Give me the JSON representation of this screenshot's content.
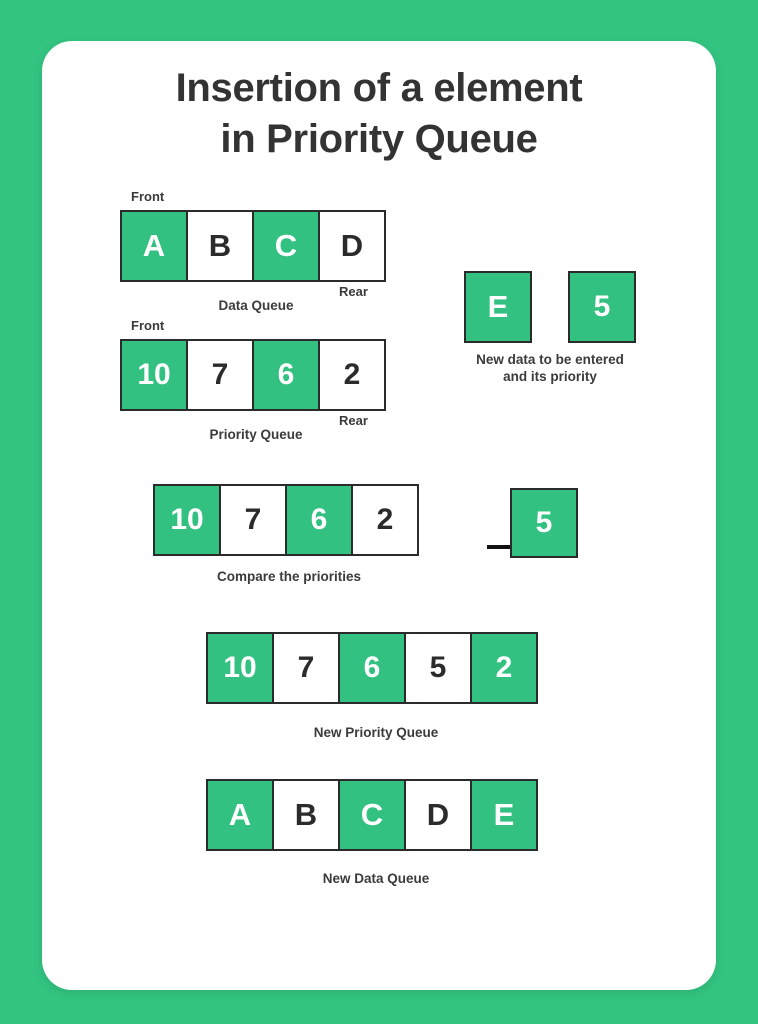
{
  "title": {
    "line1": "Insertion of a element",
    "line2": "in Priority Queue"
  },
  "colors": {
    "background_green": "#33c481",
    "cell_green": "#33c182",
    "border_dark": "#2b2b2b",
    "text_dark": "#333333",
    "card_white": "#ffffff"
  },
  "data_queue": {
    "front_label": "Front",
    "rear_label": "Rear",
    "caption": "Data Queue",
    "cells": [
      {
        "value": "A",
        "filled": true
      },
      {
        "value": "B",
        "filled": false
      },
      {
        "value": "C",
        "filled": true
      },
      {
        "value": "D",
        "filled": false
      }
    ]
  },
  "priority_queue": {
    "front_label": "Front",
    "rear_label": "Rear",
    "caption": "Priority Queue",
    "cells": [
      {
        "value": "10",
        "filled": true
      },
      {
        "value": "7",
        "filled": false
      },
      {
        "value": "6",
        "filled": true
      },
      {
        "value": "2",
        "filled": false
      }
    ]
  },
  "new_data": {
    "caption_line1": "New data to be entered",
    "caption_line2": "and its priority",
    "data_box": "E",
    "priority_box": "5"
  },
  "compare": {
    "caption": "Compare the priorities",
    "arrow_icon": "arrow-right-icon",
    "cells": [
      {
        "value": "10",
        "filled": true
      },
      {
        "value": "7",
        "filled": false
      },
      {
        "value": "6",
        "filled": true
      },
      {
        "value": "2",
        "filled": false
      }
    ],
    "incoming_priority": "5"
  },
  "new_priority_queue": {
    "caption": "New Priority Queue",
    "cells": [
      {
        "value": "10",
        "filled": true
      },
      {
        "value": "7",
        "filled": false
      },
      {
        "value": "6",
        "filled": true
      },
      {
        "value": "5",
        "filled": false
      },
      {
        "value": "2",
        "filled": true
      }
    ]
  },
  "new_data_queue": {
    "caption": "New Data Queue",
    "cells": [
      {
        "value": "A",
        "filled": true
      },
      {
        "value": "B",
        "filled": false
      },
      {
        "value": "C",
        "filled": true
      },
      {
        "value": "D",
        "filled": false
      },
      {
        "value": "E",
        "filled": true
      }
    ]
  }
}
